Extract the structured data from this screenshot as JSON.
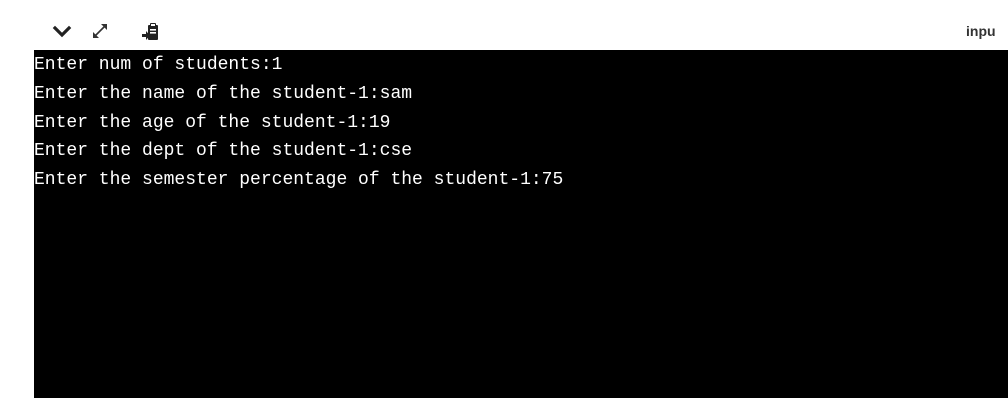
{
  "toolbar": {
    "icons": [
      "chevron-down-icon",
      "expand-icon",
      "clipboard-icon"
    ],
    "input_label": "inpu"
  },
  "terminal": {
    "background": "#000000",
    "foreground": "#ffffff",
    "lines": [
      "Enter num of students:1",
      "Enter the name of the student-1:sam",
      "Enter the age of the student-1:19",
      "Enter the dept of the student-1:cse",
      "Enter the semester percentage of the student-1:75"
    ]
  }
}
